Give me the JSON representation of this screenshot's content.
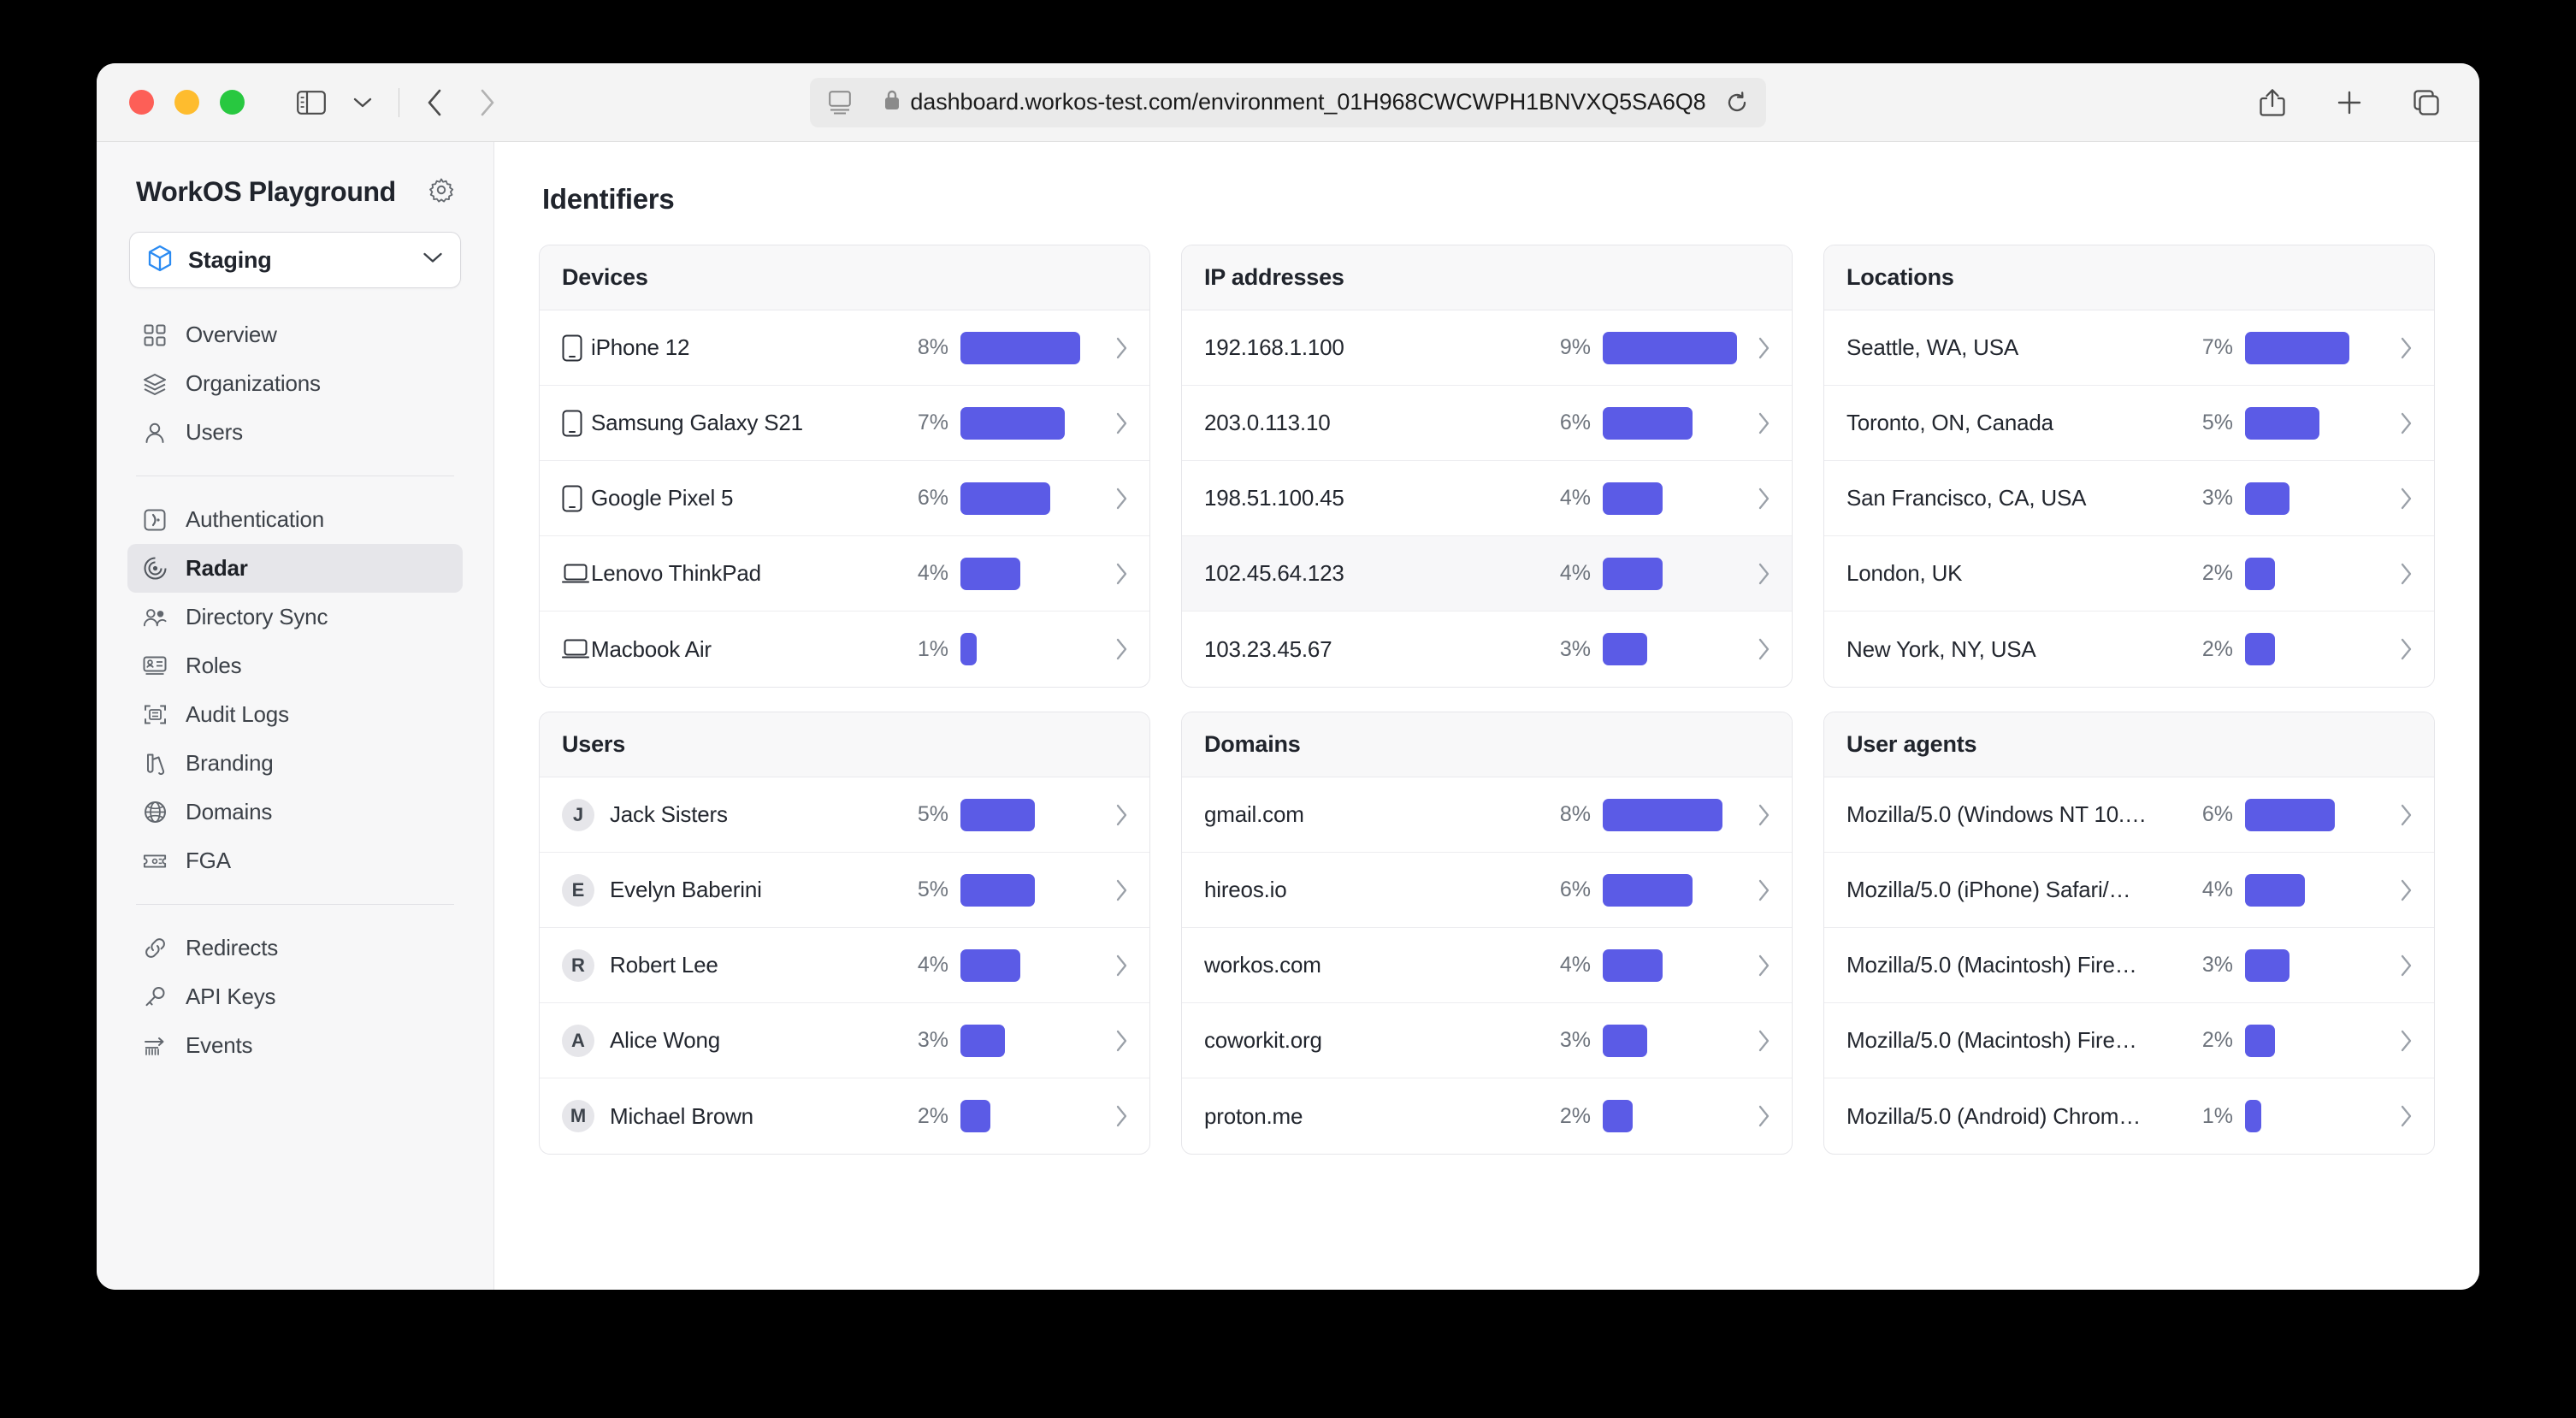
{
  "browser": {
    "url": "dashboard.workos-test.com/environment_01H968CWCWPH1BNVXQ5SA6Q8",
    "lock_icon": "lock-icon",
    "reader_icon": "reader-view-icon",
    "reload_icon": "reload-icon",
    "sidebar_toggle_icon": "sidebar-toggle-icon",
    "tab_overview_icon": "chevron-down-icon",
    "back_icon": "back-arrow-icon",
    "forward_icon": "forward-arrow-icon",
    "share_icon": "share-icon",
    "new_tab_icon": "plus-icon",
    "tabs_icon": "tab-overview-icon"
  },
  "sidebar": {
    "brand": "WorkOS Playground",
    "settings_icon": "gear-icon",
    "environment": {
      "name": "Staging",
      "cube_icon": "cube-icon",
      "chevron_icon": "chevron-down-icon"
    },
    "groups": [
      {
        "items": [
          {
            "label": "Overview",
            "icon": "grid-icon",
            "active": false
          },
          {
            "label": "Organizations",
            "icon": "layers-icon",
            "active": false
          },
          {
            "label": "Users",
            "icon": "user-icon",
            "active": false
          }
        ]
      },
      {
        "items": [
          {
            "label": "Authentication",
            "icon": "auth-key-icon",
            "active": false
          },
          {
            "label": "Radar",
            "icon": "radar-icon",
            "active": true
          },
          {
            "label": "Directory Sync",
            "icon": "users-group-icon",
            "active": false
          },
          {
            "label": "Roles",
            "icon": "id-card-icon",
            "active": false
          },
          {
            "label": "Audit Logs",
            "icon": "audit-scan-icon",
            "active": false
          },
          {
            "label": "Branding",
            "icon": "palette-icon",
            "active": false
          },
          {
            "label": "Domains",
            "icon": "globe-icon",
            "active": false
          },
          {
            "label": "FGA",
            "icon": "ticket-icon",
            "active": false
          }
        ]
      },
      {
        "items": [
          {
            "label": "Redirects",
            "icon": "link-icon",
            "active": false
          },
          {
            "label": "API Keys",
            "icon": "key-icon",
            "active": false
          },
          {
            "label": "Events",
            "icon": "events-bars-icon",
            "active": false
          }
        ]
      }
    ]
  },
  "main": {
    "title": "Identifiers",
    "chevron_icon": "chevron-right-icon",
    "bar_color": "#5b5be6",
    "cards": [
      {
        "title": "Devices",
        "kind": "icon",
        "rows": [
          {
            "label": "iPhone 12",
            "pct": "8%",
            "value": 8,
            "icon": "phone-icon",
            "hover": false
          },
          {
            "label": "Samsung Galaxy S21",
            "pct": "7%",
            "value": 7,
            "icon": "phone-icon",
            "hover": false
          },
          {
            "label": "Google Pixel 5",
            "pct": "6%",
            "value": 6,
            "icon": "phone-icon",
            "hover": false
          },
          {
            "label": "Lenovo ThinkPad",
            "pct": "4%",
            "value": 4,
            "icon": "laptop-icon",
            "hover": false
          },
          {
            "label": "Macbook Air",
            "pct": "1%",
            "value": 1,
            "icon": "laptop-icon",
            "hover": false
          }
        ]
      },
      {
        "title": "IP addresses",
        "kind": "plain",
        "rows": [
          {
            "label": "192.168.1.100",
            "pct": "9%",
            "value": 9,
            "hover": false
          },
          {
            "label": "203.0.113.10",
            "pct": "6%",
            "value": 6,
            "hover": false
          },
          {
            "label": "198.51.100.45",
            "pct": "4%",
            "value": 4,
            "hover": false
          },
          {
            "label": "102.45.64.123",
            "pct": "4%",
            "value": 4,
            "hover": true
          },
          {
            "label": "103.23.45.67",
            "pct": "3%",
            "value": 3,
            "hover": false
          }
        ]
      },
      {
        "title": "Locations",
        "kind": "plain",
        "rows": [
          {
            "label": "Seattle, WA, USA",
            "pct": "7%",
            "value": 7,
            "hover": false
          },
          {
            "label": "Toronto, ON, Canada",
            "pct": "5%",
            "value": 5,
            "hover": false
          },
          {
            "label": "San Francisco, CA, USA",
            "pct": "3%",
            "value": 3,
            "hover": false
          },
          {
            "label": "London, UK",
            "pct": "2%",
            "value": 2,
            "hover": false
          },
          {
            "label": "New York, NY, USA",
            "pct": "2%",
            "value": 2,
            "hover": false
          }
        ]
      },
      {
        "title": "Users",
        "kind": "avatar",
        "rows": [
          {
            "label": "Jack Sisters",
            "pct": "5%",
            "value": 5,
            "initial": "J",
            "hover": false
          },
          {
            "label": "Evelyn Baberini",
            "pct": "5%",
            "value": 5,
            "initial": "E",
            "hover": false
          },
          {
            "label": "Robert Lee",
            "pct": "4%",
            "value": 4,
            "initial": "R",
            "hover": false
          },
          {
            "label": "Alice Wong",
            "pct": "3%",
            "value": 3,
            "initial": "A",
            "hover": false
          },
          {
            "label": "Michael Brown",
            "pct": "2%",
            "value": 2,
            "initial": "M",
            "hover": false
          }
        ]
      },
      {
        "title": "Domains",
        "kind": "plain",
        "rows": [
          {
            "label": "gmail.com",
            "pct": "8%",
            "value": 8,
            "hover": false
          },
          {
            "label": "hireos.io",
            "pct": "6%",
            "value": 6,
            "hover": false
          },
          {
            "label": "workos.com",
            "pct": "4%",
            "value": 4,
            "hover": false
          },
          {
            "label": "coworkit.org",
            "pct": "3%",
            "value": 3,
            "hover": false
          },
          {
            "label": "proton.me",
            "pct": "2%",
            "value": 2,
            "hover": false
          }
        ]
      },
      {
        "title": "User agents",
        "kind": "plain",
        "rows": [
          {
            "label": "Mozilla/5.0 (Windows NT 10.…",
            "pct": "6%",
            "value": 6,
            "hover": false
          },
          {
            "label": "Mozilla/5.0 (iPhone) Safari/…",
            "pct": "4%",
            "value": 4,
            "hover": false
          },
          {
            "label": "Mozilla/5.0 (Macintosh) Fire…",
            "pct": "3%",
            "value": 3,
            "hover": false
          },
          {
            "label": "Mozilla/5.0 (Macintosh) Fire…",
            "pct": "2%",
            "value": 2,
            "hover": false
          },
          {
            "label": "Mozilla/5.0 (Android) Chrom…",
            "pct": "1%",
            "value": 1,
            "hover": false
          }
        ]
      }
    ]
  },
  "chart_data": {
    "type": "bar",
    "title": "Identifiers",
    "orientation": "horizontal",
    "value_unit": "percent",
    "max_value": 9,
    "panels": [
      {
        "name": "Devices",
        "categories": [
          "iPhone 12",
          "Samsung Galaxy S21",
          "Google Pixel 5",
          "Lenovo ThinkPad",
          "Macbook Air"
        ],
        "values": [
          8,
          7,
          6,
          4,
          1
        ]
      },
      {
        "name": "IP addresses",
        "categories": [
          "192.168.1.100",
          "203.0.113.10",
          "198.51.100.45",
          "102.45.64.123",
          "103.23.45.67"
        ],
        "values": [
          9,
          6,
          4,
          4,
          3
        ]
      },
      {
        "name": "Locations",
        "categories": [
          "Seattle, WA, USA",
          "Toronto, ON, Canada",
          "San Francisco, CA, USA",
          "London, UK",
          "New York, NY, USA"
        ],
        "values": [
          7,
          5,
          3,
          2,
          2
        ]
      },
      {
        "name": "Users",
        "categories": [
          "Jack Sisters",
          "Evelyn Baberini",
          "Robert Lee",
          "Alice Wong",
          "Michael Brown"
        ],
        "values": [
          5,
          5,
          4,
          3,
          2
        ]
      },
      {
        "name": "Domains",
        "categories": [
          "gmail.com",
          "hireos.io",
          "workos.com",
          "coworkit.org",
          "proton.me"
        ],
        "values": [
          8,
          6,
          4,
          3,
          2
        ]
      },
      {
        "name": "User agents",
        "categories": [
          "Mozilla/5.0 (Windows NT 10.…",
          "Mozilla/5.0 (iPhone) Safari/…",
          "Mozilla/5.0 (Macintosh) Fire…",
          "Mozilla/5.0 (Macintosh) Fire…",
          "Mozilla/5.0 (Android) Chrom…"
        ],
        "values": [
          6,
          4,
          3,
          2,
          1
        ]
      }
    ]
  }
}
